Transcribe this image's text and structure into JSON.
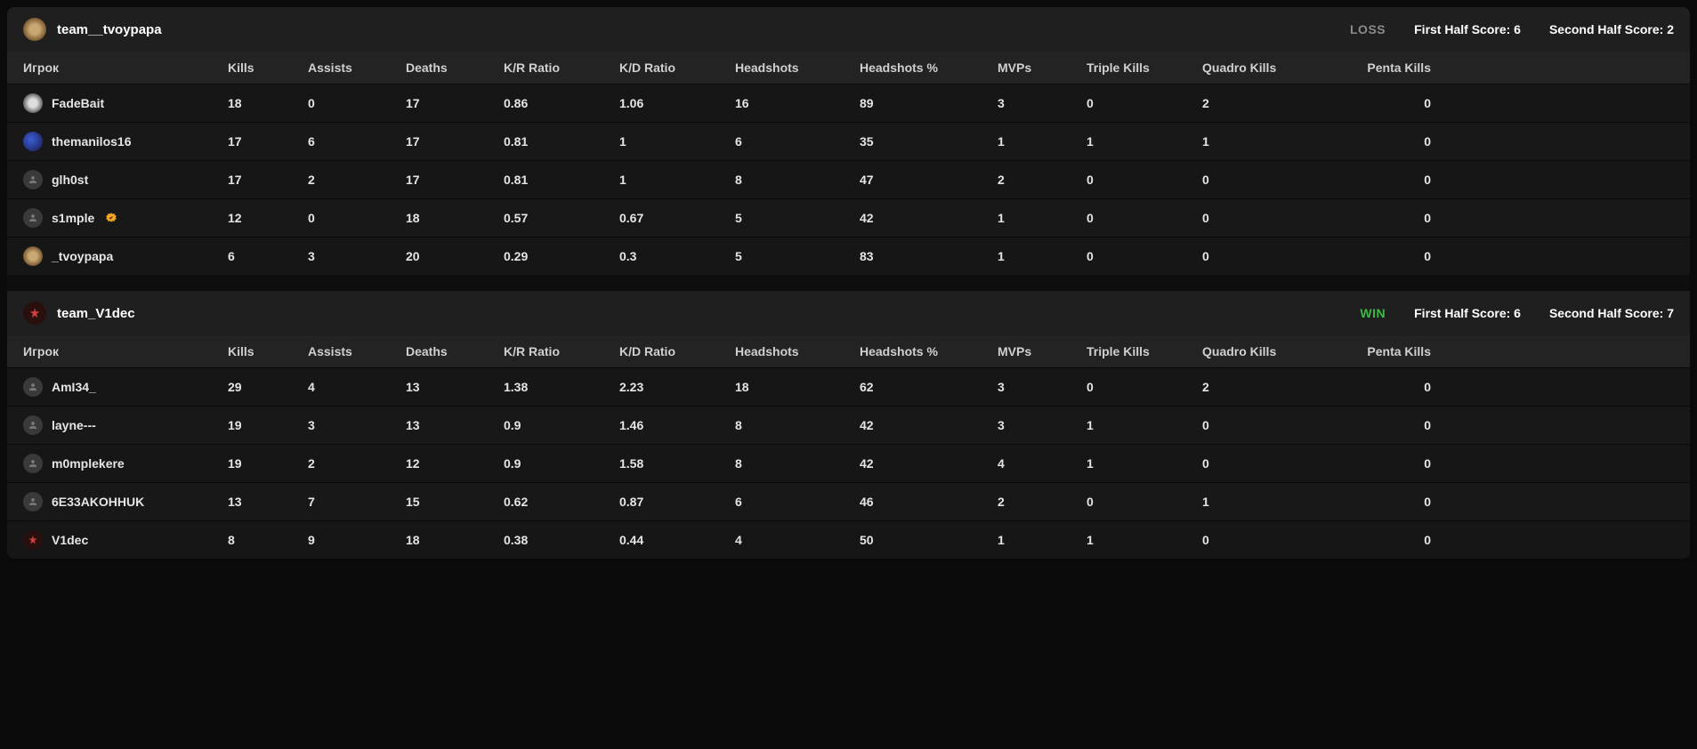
{
  "columns": {
    "player": "Игрок",
    "kills": "Kills",
    "assists": "Assists",
    "deaths": "Deaths",
    "kr": "K/R Ratio",
    "kd": "K/D Ratio",
    "hs": "Headshots",
    "hsp": "Headshots %",
    "mvps": "MVPs",
    "tk": "Triple Kills",
    "qk": "Quadro Kills",
    "pk": "Penta Kills"
  },
  "teams": [
    {
      "name": "team__tvoypapa",
      "logo": "cheetah",
      "result": "LOSS",
      "result_class": "loss",
      "first_half_label": "First Half Score: 6",
      "second_half_label": "Second Half Score: 2",
      "players": [
        {
          "name": "FadeBait",
          "avatar": "gray",
          "verified": false,
          "kills": "18",
          "assists": "0",
          "deaths": "17",
          "kr": "0.86",
          "kd": "1.06",
          "hs": "16",
          "hsp": "89",
          "mvps": "3",
          "tk": "0",
          "qk": "2",
          "pk": "0"
        },
        {
          "name": "themanilos16",
          "avatar": "blue",
          "verified": false,
          "kills": "17",
          "assists": "6",
          "deaths": "17",
          "kr": "0.81",
          "kd": "1",
          "hs": "6",
          "hsp": "35",
          "mvps": "1",
          "tk": "1",
          "qk": "1",
          "pk": "0"
        },
        {
          "name": "glh0st",
          "avatar": "default",
          "verified": false,
          "kills": "17",
          "assists": "2",
          "deaths": "17",
          "kr": "0.81",
          "kd": "1",
          "hs": "8",
          "hsp": "47",
          "mvps": "2",
          "tk": "0",
          "qk": "0",
          "pk": "0"
        },
        {
          "name": "s1mple",
          "avatar": "default",
          "verified": true,
          "kills": "12",
          "assists": "0",
          "deaths": "18",
          "kr": "0.57",
          "kd": "0.67",
          "hs": "5",
          "hsp": "42",
          "mvps": "1",
          "tk": "0",
          "qk": "0",
          "pk": "0"
        },
        {
          "name": "_tvoypapa",
          "avatar": "cheetah",
          "verified": false,
          "kills": "6",
          "assists": "3",
          "deaths": "20",
          "kr": "0.29",
          "kd": "0.3",
          "hs": "5",
          "hsp": "83",
          "mvps": "1",
          "tk": "0",
          "qk": "0",
          "pk": "0"
        }
      ]
    },
    {
      "name": "team_V1dec",
      "logo": "red",
      "result": "WIN",
      "result_class": "win",
      "first_half_label": "First Half Score: 6",
      "second_half_label": "Second Half Score: 7",
      "players": [
        {
          "name": "AmI34_",
          "avatar": "default",
          "verified": false,
          "kills": "29",
          "assists": "4",
          "deaths": "13",
          "kr": "1.38",
          "kd": "2.23",
          "hs": "18",
          "hsp": "62",
          "mvps": "3",
          "tk": "0",
          "qk": "2",
          "pk": "0"
        },
        {
          "name": "layne---",
          "avatar": "default",
          "verified": false,
          "kills": "19",
          "assists": "3",
          "deaths": "13",
          "kr": "0.9",
          "kd": "1.46",
          "hs": "8",
          "hsp": "42",
          "mvps": "3",
          "tk": "1",
          "qk": "0",
          "pk": "0"
        },
        {
          "name": "m0mplekere",
          "avatar": "default",
          "verified": false,
          "kills": "19",
          "assists": "2",
          "deaths": "12",
          "kr": "0.9",
          "kd": "1.58",
          "hs": "8",
          "hsp": "42",
          "mvps": "4",
          "tk": "1",
          "qk": "0",
          "pk": "0"
        },
        {
          "name": "6E33AKOHHUK",
          "avatar": "default",
          "verified": false,
          "kills": "13",
          "assists": "7",
          "deaths": "15",
          "kr": "0.62",
          "kd": "0.87",
          "hs": "6",
          "hsp": "46",
          "mvps": "2",
          "tk": "0",
          "qk": "1",
          "pk": "0"
        },
        {
          "name": "V1dec",
          "avatar": "red",
          "verified": false,
          "kills": "8",
          "assists": "9",
          "deaths": "18",
          "kr": "0.38",
          "kd": "0.44",
          "hs": "4",
          "hsp": "50",
          "mvps": "1",
          "tk": "1",
          "qk": "0",
          "pk": "0"
        }
      ]
    }
  ]
}
